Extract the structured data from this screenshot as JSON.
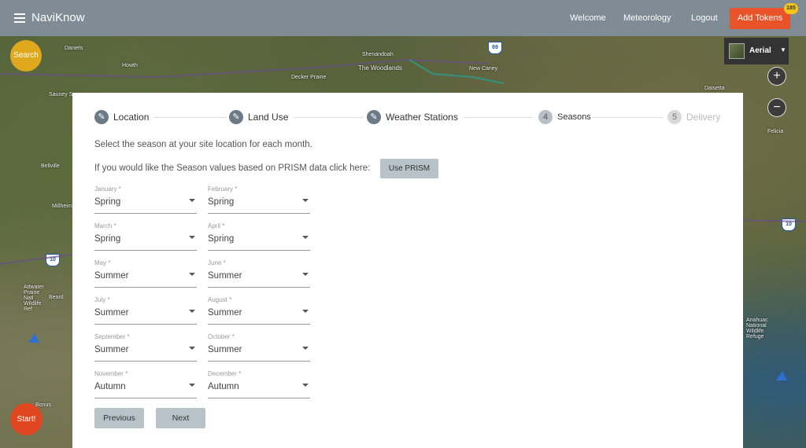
{
  "header": {
    "brand": "NaviKnow",
    "nav": [
      "Welcome",
      "Meteorology",
      "Logout"
    ],
    "add_tokens_label": "Add Tokens",
    "token_count": "185"
  },
  "map": {
    "search_label": "Search",
    "start_label": "Start!",
    "layer_label": "Aerial",
    "zoom_in": "+",
    "zoom_out": "−",
    "places": [
      "Daniels",
      "Howth",
      "Shenandoah",
      "The Woodlands",
      "Decker Prairie",
      "New Caney",
      "Daisetta",
      "Sauney S",
      "Bellville",
      "Millheim",
      "Felicia",
      "Attwater Prairie Natl Wildlife Ref",
      "Beard",
      "Anahuac National Wildlife Refuge",
      "Bonus"
    ],
    "highways": [
      "69",
      "10",
      "10"
    ]
  },
  "wizard": {
    "steps": [
      {
        "label": "Location",
        "icon": "pencil-icon",
        "state": "done"
      },
      {
        "label": "Land Use",
        "icon": "pencil-icon",
        "state": "done"
      },
      {
        "label": "Weather Stations",
        "icon": "pencil-icon",
        "state": "done"
      },
      {
        "label": "Seasons",
        "number": "4",
        "state": "active"
      },
      {
        "label": "Delivery",
        "number": "5",
        "state": "pending"
      }
    ],
    "intro": "Select the season at your site location for each month.",
    "prism_text": "If you would like the Season values based on PRISM data click here:",
    "prism_button": "Use PRISM",
    "months": [
      {
        "label": "January *",
        "value": "Spring"
      },
      {
        "label": "February *",
        "value": "Spring"
      },
      {
        "label": "March *",
        "value": "Spring"
      },
      {
        "label": "April *",
        "value": "Spring"
      },
      {
        "label": "May *",
        "value": "Summer"
      },
      {
        "label": "June *",
        "value": "Summer"
      },
      {
        "label": "July *",
        "value": "Summer"
      },
      {
        "label": "August *",
        "value": "Summer"
      },
      {
        "label": "September *",
        "value": "Summer"
      },
      {
        "label": "October *",
        "value": "Summer"
      },
      {
        "label": "November *",
        "value": "Autumn"
      },
      {
        "label": "December *",
        "value": "Autumn"
      }
    ],
    "previous_label": "Previous",
    "next_label": "Next"
  }
}
